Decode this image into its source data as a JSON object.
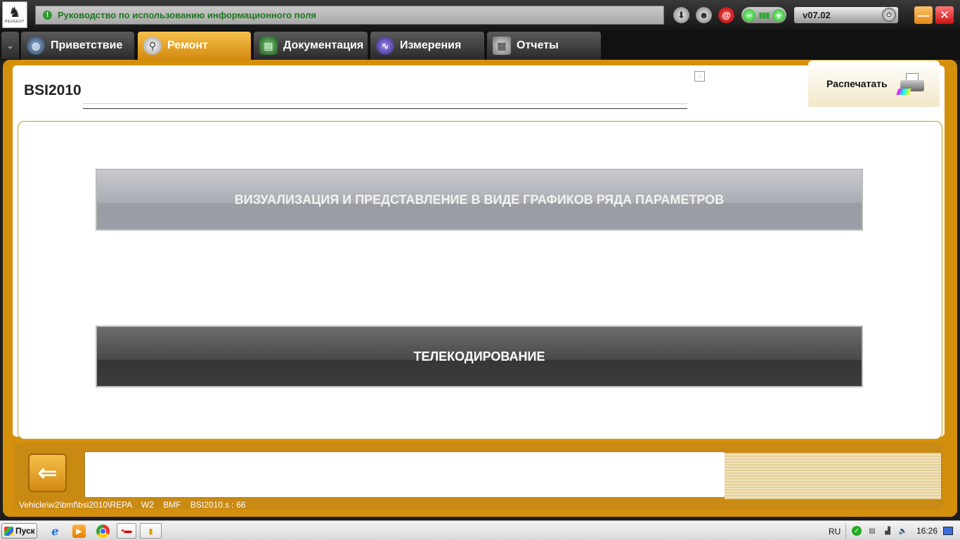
{
  "window": {
    "info_text": "Руководство по использованию информационного поля",
    "info_icon": "!",
    "version": "v07.02",
    "logo_text": "PEUGEOT"
  },
  "tabs": [
    {
      "label": "Приветствие",
      "icon": "globe-icon"
    },
    {
      "label": "Ремонт",
      "icon": "magnifier-icon",
      "active": true
    },
    {
      "label": "Документация",
      "icon": "book-icon"
    },
    {
      "label": "Измерения",
      "icon": "waveform-icon"
    },
    {
      "label": "Отчеты",
      "icon": "report-icon"
    }
  ],
  "panel": {
    "title": "BSI2010",
    "print_label": "Распечатать",
    "small_box": "·"
  },
  "actions": {
    "visualize": "ВИЗУАЛИЗАЦИЯ И ПРЕДСТАВЛЕНИЕ В ВИДЕ ГРАФИКОВ РЯДА ПАРАМЕТРОВ",
    "telecoding": "ТЕЛЕКОДИРОВАНИЕ"
  },
  "bottom": {
    "path": "Vehicle\\w2\\bmf\\bsi2010\\REPA    W2    BMF    BSI2010.s : 66"
  },
  "taskbar": {
    "start_label": "Пуск",
    "language": "RU",
    "clock": "16:26"
  },
  "colors": {
    "frame_orange": "#d4900c",
    "tab_active": "#f0b030",
    "info_green": "#1a7a1a"
  }
}
